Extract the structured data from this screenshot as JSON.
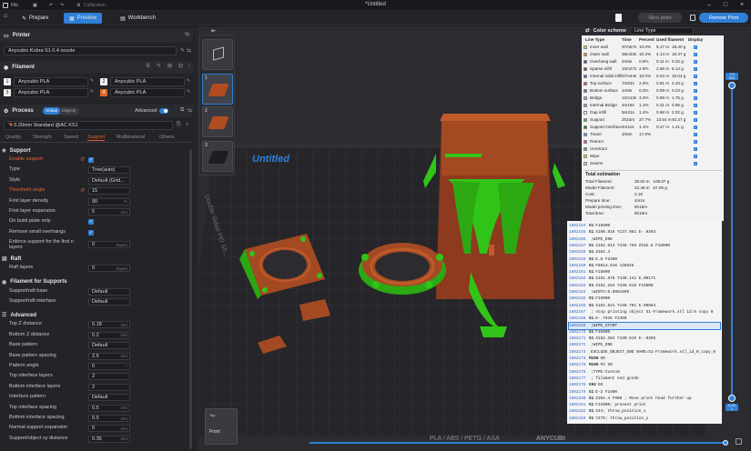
{
  "titlebar": {
    "app_menu": "File",
    "calibration": "Calibration",
    "doc_title": "*Untitled"
  },
  "tabs": [
    {
      "label": "Prepare"
    },
    {
      "label": "Preview"
    },
    {
      "label": "Workbench"
    }
  ],
  "actions": {
    "slice_plate": "Slice plate",
    "remote_print": "Remote Print"
  },
  "printer": {
    "section": "Printer",
    "name": "Anycubic Kobra S1 0.4 nozzle"
  },
  "filament": {
    "section": "Filament",
    "slots": [
      {
        "num": "1",
        "name": "Anycubic PLA",
        "color": "#f0f0f0"
      },
      {
        "num": "2",
        "name": "Anycubic PLA",
        "color": "#f0f0f0"
      },
      {
        "num": "3",
        "name": "Anycubic PLA",
        "color": "#f0f0f0"
      },
      {
        "num": "4",
        "name": "Anycubic PLA",
        "color": "#e06a2c"
      }
    ]
  },
  "process": {
    "section": "Process",
    "toggle_global": "Global",
    "toggle_objects": "Objects",
    "advanced": "Advanced",
    "preset": "0.20mm Standard @AC KS1",
    "tabs": [
      "Quality",
      "Strength",
      "Speed",
      "Support",
      "Multimaterial",
      "Others"
    ],
    "active_tab": "Support"
  },
  "support": {
    "group": "Support",
    "rows": [
      {
        "label": "Enable support",
        "kind": "check",
        "orange": true
      },
      {
        "label": "Type",
        "kind": "select",
        "value": "Tree(auto)"
      },
      {
        "label": "Style",
        "kind": "select",
        "value": "Default (Grid..."
      },
      {
        "label": "Threshold angle",
        "kind": "num",
        "value": "15",
        "unit": "",
        "orange": true
      },
      {
        "label": "First layer density",
        "kind": "num",
        "value": "90",
        "unit": "%"
      },
      {
        "label": "First layer expansion",
        "kind": "num",
        "value": "5",
        "unit": "mm"
      },
      {
        "label": "On build plate only",
        "kind": "check"
      },
      {
        "label": "Remove small overhangs",
        "kind": "check"
      },
      {
        "label": "Enforce support for the first n layers",
        "kind": "num",
        "value": "0",
        "unit": "layers"
      }
    ]
  },
  "raft": {
    "group": "Raft",
    "rows": [
      {
        "label": "Raft layers",
        "kind": "num",
        "value": "0",
        "unit": "layers"
      }
    ]
  },
  "filament_supports": {
    "group": "Filament for Supports",
    "rows": [
      {
        "label": "Support/raft base",
        "kind": "select",
        "value": "Default"
      },
      {
        "label": "Support/raft interface",
        "kind": "select",
        "value": "Default"
      }
    ]
  },
  "advanced_group": {
    "group": "Advanced",
    "rows": [
      {
        "label": "Top Z distance",
        "kind": "num",
        "value": "0.18",
        "unit": "mm"
      },
      {
        "label": "Bottom Z distance",
        "kind": "num",
        "value": "0.2",
        "unit": "mm"
      },
      {
        "label": "Base pattern",
        "kind": "select",
        "value": "Default"
      },
      {
        "label": "Base pattern spacing",
        "kind": "num",
        "value": "2.5",
        "unit": "mm"
      },
      {
        "label": "Pattern angle",
        "kind": "num",
        "value": "0",
        "unit": "°"
      },
      {
        "label": "Top interface layers",
        "kind": "select",
        "value": "2"
      },
      {
        "label": "Bottom interface layers",
        "kind": "select",
        "value": "2"
      },
      {
        "label": "Interface pattern",
        "kind": "select",
        "value": "Default"
      },
      {
        "label": "Top interface spacing",
        "kind": "num",
        "value": "0.5",
        "unit": "mm"
      },
      {
        "label": "Bottom interface spacing",
        "kind": "num",
        "value": "0.5",
        "unit": "mm"
      },
      {
        "label": "Normal support expansion",
        "kind": "num",
        "value": "0",
        "unit": "mm"
      },
      {
        "label": "Support/object xy distance",
        "kind": "num",
        "value": "0.35",
        "unit": "mm"
      }
    ]
  },
  "plates": [
    "1",
    "2",
    "3"
  ],
  "viewport": {
    "plate_label": "Untitled",
    "bed_text": "PLA / ABS / PETG / ASA",
    "bed_brand": "ANYCUBI",
    "side_text": "Double Sided PEI Sh...",
    "view_front": "Front",
    "view_top": "Top"
  },
  "legend": {
    "title": "Color scheme",
    "scheme": "Line Type",
    "headers": [
      "Line Type",
      "Time",
      "Percent",
      "Used filament",
      "Display"
    ],
    "rows": [
      {
        "name": "Inner wall",
        "color": "#f2c94c",
        "time": "37m57s",
        "pct": "10.0%",
        "m": "6.17 m",
        "g": "18.40 g"
      },
      {
        "name": "Outer wall",
        "color": "#ff8a2b",
        "time": "38m33s",
        "pct": "10.2%",
        "m": "4.14 m",
        "g": "18.37 g"
      },
      {
        "name": "Overhang wall",
        "color": "#3a4bd6",
        "time": "2m5s",
        "pct": "0.6%",
        "m": "0.11 m",
        "g": "0.32 g"
      },
      {
        "name": "Sparse infill",
        "color": "#a8322c",
        "time": "10m27s",
        "pct": "2.8%",
        "m": "2.56 m",
        "g": "6.14 g"
      },
      {
        "name": "Internal solid infill",
        "color": "#9a3bd2",
        "time": "37m44s",
        "pct": "10.0%",
        "m": "5.04 m",
        "g": "15.04 g"
      },
      {
        "name": "Top surface",
        "color": "#ff4060",
        "time": "7m53s",
        "pct": "2.0%",
        "m": "0.81 m",
        "g": "2.43 g"
      },
      {
        "name": "Bottom surface",
        "color": "#6a6adc",
        "time": "1m8s",
        "pct": "0.3%",
        "m": "0.08 m",
        "g": "0.23 g"
      },
      {
        "name": "Bridge",
        "color": "#6ab0e0",
        "time": "12m13s",
        "pct": "3.2%",
        "m": "0.99 m",
        "g": "1.75 g"
      },
      {
        "name": "Internal Bridge",
        "color": "#6ab0e0",
        "time": "4m18s",
        "pct": "1.1%",
        "m": "0.31 m",
        "g": "0.95 g"
      },
      {
        "name": "Gap infill",
        "color": "#ffffff",
        "time": "5m21s",
        "pct": "1.4%",
        "m": "0.68 m",
        "g": "2.02 g"
      },
      {
        "name": "Support",
        "color": "#31c418",
        "time": "2h23m",
        "pct": "37.7%",
        "m": "13.54 m",
        "g": "40.37 g"
      },
      {
        "name": "Support interface",
        "color": "#1e7a20",
        "time": "4m11s",
        "pct": "1.1%",
        "m": "0.47 m",
        "g": "1.41 g"
      },
      {
        "name": "Travel",
        "color": "#3c9cf0",
        "time": "1h8m",
        "pct": "17.8%",
        "m": "",
        "g": ""
      },
      {
        "name": "Retract",
        "color": "#ff40d0",
        "time": "",
        "pct": "",
        "m": "",
        "g": ""
      },
      {
        "name": "Unretract",
        "color": "#30b0a0",
        "time": "",
        "pct": "",
        "m": "",
        "g": ""
      },
      {
        "name": "Wipe",
        "color": "#f0d020",
        "time": "",
        "pct": "",
        "m": "",
        "g": ""
      },
      {
        "name": "Seams",
        "color": "#d0d0d0",
        "time": "",
        "pct": "",
        "m": "",
        "g": ""
      }
    ],
    "estimation_title": "Total estimation",
    "estimation": [
      {
        "label": "Total Filament:",
        "value": "36.50 m   108.87 g"
      },
      {
        "label": "Model Filament:",
        "value": "22.49 m   67.09 g"
      },
      {
        "label": "Cost:",
        "value": "2.18"
      },
      {
        "label": "Prepare time:",
        "value": "4m1s"
      },
      {
        "label": "Model printing time:",
        "value": "6h15m"
      },
      {
        "label": "Total time:",
        "value": "6h19m"
      }
    ]
  },
  "gcode": [
    {
      "n": "1802154",
      "cmd": "G1",
      "rest": "F15000"
    },
    {
      "n": "1802155",
      "cmd": "G1",
      "rest": "X160.816 Y137.061 E-.0364"
    },
    {
      "n": "1802156",
      "cmd": "",
      "rest": ";WIPE_END"
    },
    {
      "n": "1802157",
      "cmd": "G1",
      "rest": "X162.814 Y138.758 Z102.8 F18000"
    },
    {
      "n": "1802158",
      "cmd": "G1",
      "rest": "Z102.4"
    },
    {
      "n": "1802159",
      "cmd": "G1",
      "rest": "E.8 F2400"
    },
    {
      "n": "1802160",
      "cmd": "G1",
      "rest": "F8814.816 136826"
    },
    {
      "n": "1802161",
      "cmd": "G1",
      "rest": "F15000"
    },
    {
      "n": "1802162",
      "cmd": "G1",
      "rest": "X162.678 Y139.141 E.00171"
    },
    {
      "n": "1802163",
      "cmd": "G1",
      "rest": "X162.284 Y139.615 F15000"
    },
    {
      "n": "1802164",
      "cmd": "",
      "rest": ";WIDTH:0.0881695"
    },
    {
      "n": "1802165",
      "cmd": "G1",
      "rest": "F15000"
    },
    {
      "n": "1802166",
      "cmd": "G1",
      "rest": "X162.621 Y139.701 E.00084"
    },
    {
      "n": "1802167",
      "cmd": "",
      "rest": "; stop printing object S1-Framework.stl id:0 copy 0"
    },
    {
      "n": "1802168",
      "cmd": "G1",
      "rest": "E-.7635 F2400"
    },
    {
      "n": "1802169",
      "cmd": "",
      "rest": ";WIPE_START",
      "sel": true
    },
    {
      "n": "1802170",
      "cmd": "G1",
      "rest": "F15000"
    },
    {
      "n": "1802171",
      "cmd": "G1",
      "rest": "X162.284 Y139.615 E-.0365"
    },
    {
      "n": "1802172",
      "cmd": "",
      "rest": ";WIPE_END"
    },
    {
      "n": "1802173",
      "cmd": "",
      "rest": "EXCLUDE_OBJECT_END NAME=S1-Framework.stl_id_0_copy_0"
    },
    {
      "n": "1802174",
      "cmd": "M106",
      "rest": "S0"
    },
    {
      "n": "1802175",
      "cmd": "M106",
      "rest": "P2 S0"
    },
    {
      "n": "1802176",
      "cmd": "",
      "rest": ";TYPE:Custom"
    },
    {
      "n": "1802177",
      "cmd": "",
      "rest": "; filament end gcode"
    },
    {
      "n": "1802178",
      "cmd": "G92",
      "rest": "E0"
    },
    {
      "n": "1802179",
      "cmd": "G1",
      "rest": "E-2 F1800"
    },
    {
      "n": "1802180",
      "cmd": "G1",
      "rest": "Z104.4 F900 ; Move print head further up"
    },
    {
      "n": "1802181",
      "cmd": "G1",
      "rest": "F12000; present print"
    },
    {
      "n": "1802182",
      "cmd": "G1",
      "rest": "X44; throw_position_x"
    },
    {
      "n": "1802183",
      "cmd": "G1",
      "rest": "Y270; throw_position_y"
    }
  ],
  "slider": {
    "top_value": "7.9",
    "top_layer": "512",
    "bottom_value": "0.20",
    "bottom_layer": "1"
  },
  "colors": {
    "accent": "#2f7fd6",
    "brand_orange": "#e35d2c",
    "support_green": "#31c418",
    "model_orange": "#c4511e"
  }
}
